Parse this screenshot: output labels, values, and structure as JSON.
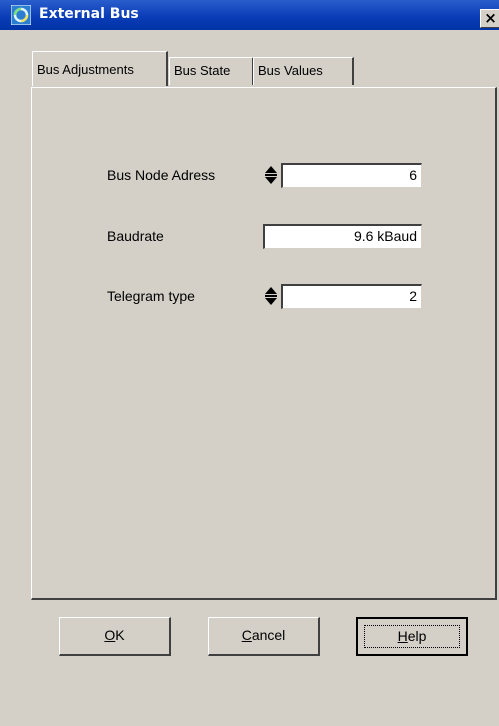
{
  "window": {
    "title": "External Bus",
    "close_symbol": "×"
  },
  "tabs": [
    {
      "label": "Bus Adjustments",
      "active": true
    },
    {
      "label": "Bus State",
      "active": false
    },
    {
      "label": "Bus Values",
      "active": false
    }
  ],
  "fields": [
    {
      "label": "Bus Node Adress",
      "value": "6",
      "has_spinner": true
    },
    {
      "label": "Baudrate",
      "value": "9.6 kBaud",
      "has_spinner": false
    },
    {
      "label": "Telegram type",
      "value": "2",
      "has_spinner": true
    }
  ],
  "buttons": {
    "ok": {
      "mnemonic": "O",
      "rest": "K"
    },
    "cancel": {
      "mnemonic": "C",
      "rest": "ancel"
    },
    "help": {
      "mnemonic": "H",
      "rest": "elp"
    }
  },
  "colors": {
    "titlebar": "#0a3db8",
    "face": "#d4d0c8"
  }
}
